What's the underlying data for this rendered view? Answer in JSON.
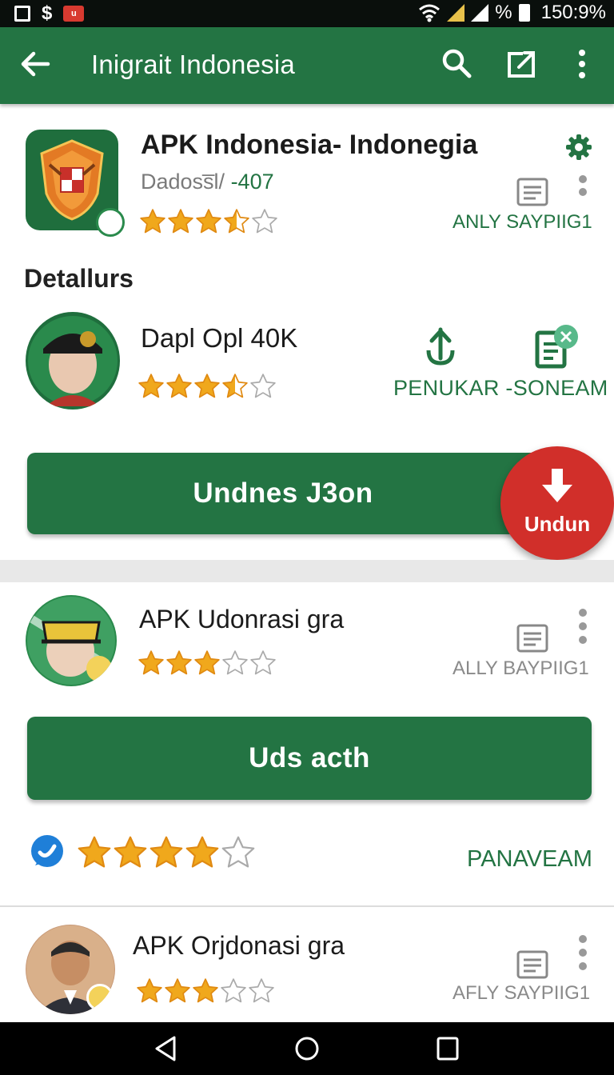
{
  "status_bar": {
    "time_battery": "150:9%",
    "percent_symbol": "%",
    "dollar": "$",
    "icons": [
      "image-icon",
      "dollar-icon",
      "notification-icon",
      "wifi-icon",
      "signal-icon",
      "battery-icon"
    ]
  },
  "toolbar": {
    "title": "Inigrait Indonesia",
    "icons": [
      "back-arrow-icon",
      "search-icon",
      "share-icon",
      "more-vert-icon"
    ],
    "color": "#237443"
  },
  "app": {
    "title": "APK Indonesia- Indonegia",
    "developer": "Dadoss̅l/",
    "count": "-407",
    "rating": 3.5,
    "side_label": "ANLY SAYPIIG1"
  },
  "details": {
    "heading": "Detallurs",
    "name": "Dapl  Opl 40K",
    "rating": 3.5,
    "action_label": "PENUKAR -SONEAM",
    "button_label": "Undnes J3on",
    "fab_label": "Undun"
  },
  "list": [
    {
      "title": "APK Udonrasi gra",
      "rating": 3,
      "side_label": "ALLY BAYPIIG1",
      "button_label": "Uds acth",
      "extra_rating": 4,
      "extra_label": "PANAVEAM"
    },
    {
      "title": "APK Orjdonasi gra",
      "rating": 3,
      "side_label": "AFLY SAYPIIG1"
    }
  ],
  "colors": {
    "primary_green": "#237443",
    "star_gold": "#f0a81c",
    "fab_red": "#d12f2a"
  }
}
